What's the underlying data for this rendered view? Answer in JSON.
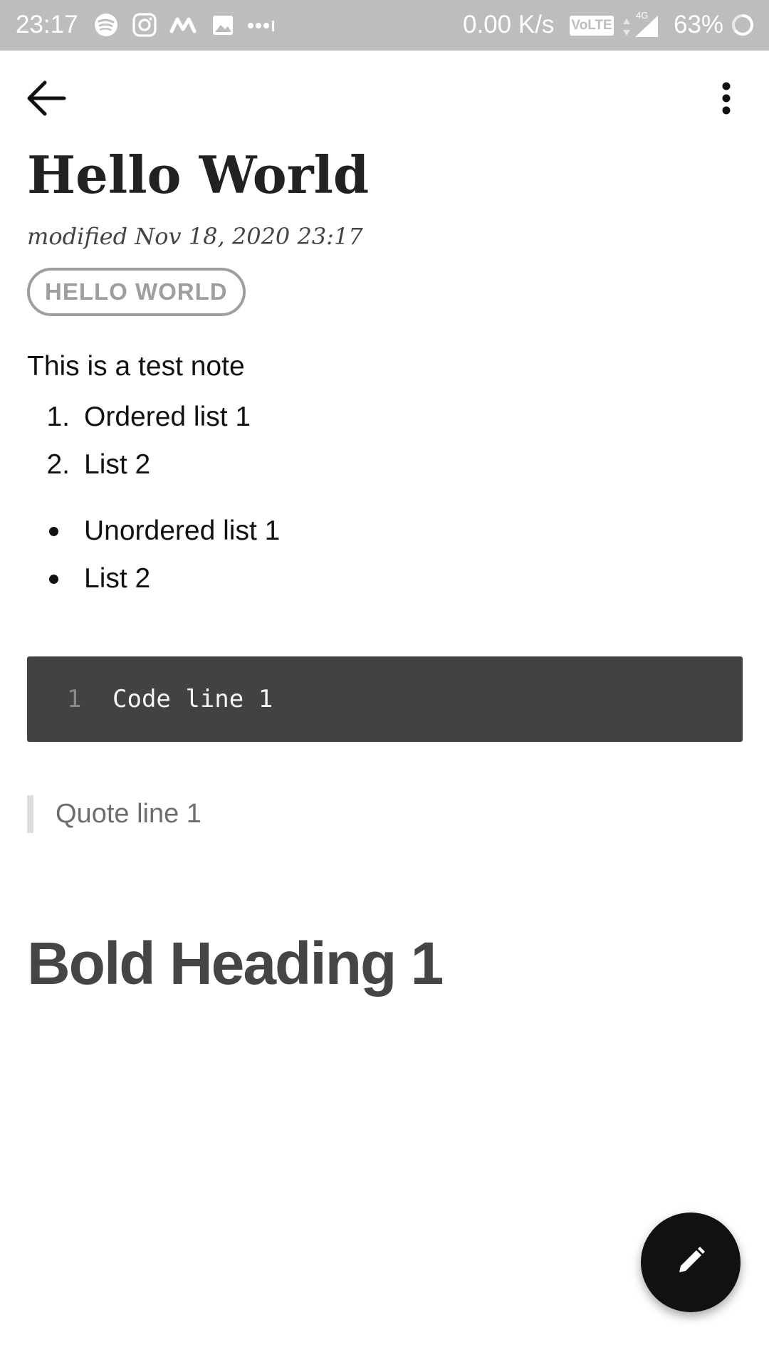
{
  "status_bar": {
    "time": "23:17",
    "network_speed": "0.00 K/s",
    "volte_label": "VoLTE",
    "network_type": "4G",
    "battery_percent": "63%",
    "icons": [
      "spotify-icon",
      "instagram-icon",
      "myntra-icon",
      "gallery-icon",
      "more-notifications-icon",
      "signal-icon",
      "battery-icon"
    ]
  },
  "toolbar": {
    "back_icon": "arrow-left-icon",
    "menu_icon": "more-vertical-icon"
  },
  "note": {
    "title": "Hello World",
    "modified": "modified Nov 18, 2020 23:17",
    "tag": "HELLO WORLD",
    "body_text": "This is a test note",
    "ordered_list": [
      {
        "marker": "1.",
        "text": "Ordered list 1"
      },
      {
        "marker": "2.",
        "text": "List 2"
      }
    ],
    "unordered_list": [
      {
        "text": "Unordered list 1"
      },
      {
        "text": "List 2"
      }
    ],
    "code": {
      "line_number": "1",
      "line_text": "Code line 1"
    },
    "quote": "Quote line 1",
    "heading": "Bold Heading 1"
  },
  "fab": {
    "icon": "edit-pencil-icon"
  },
  "colors": {
    "status_bar_bg": "#bdbdbd",
    "code_bg": "#424242",
    "fab_bg": "#111111",
    "tag_border": "#9e9e9e"
  }
}
